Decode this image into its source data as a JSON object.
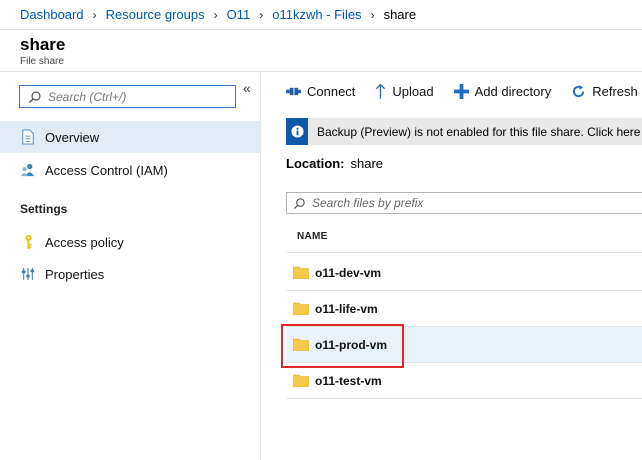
{
  "breadcrumb": {
    "items": [
      "Dashboard",
      "Resource groups",
      "O11",
      "o11kzwh - Files"
    ],
    "current": "share"
  },
  "header": {
    "title": "share",
    "subtitle": "File share"
  },
  "sidebar": {
    "search_placeholder": "Search (Ctrl+/)",
    "collapse_glyph": "«",
    "items": [
      {
        "label": "Overview",
        "icon": "document-icon",
        "active": true
      },
      {
        "label": "Access Control (IAM)",
        "icon": "users-icon",
        "active": false
      }
    ],
    "settings_label": "Settings",
    "settings_items": [
      {
        "label": "Access policy",
        "icon": "key-icon"
      },
      {
        "label": "Properties",
        "icon": "sliders-icon"
      }
    ]
  },
  "toolbar": {
    "connect": "Connect",
    "upload": "Upload",
    "add_directory": "Add directory",
    "refresh": "Refresh"
  },
  "info": {
    "message": "Backup (Preview) is not enabled for this file share. Click here to"
  },
  "location": {
    "label": "Location:",
    "value": "share"
  },
  "files": {
    "search_placeholder": "Search files by prefix",
    "column_name": "NAME",
    "rows": [
      "o11-dev-vm",
      "o11-life-vm",
      "o11-prod-vm",
      "o11-test-vm"
    ],
    "selected_index": 2
  },
  "colors": {
    "link": "#0058ad",
    "accent": "#0f5aa6",
    "active_bg": "#e1ecf7",
    "highlight": "#e0262b",
    "folder": "#f5c94c"
  }
}
